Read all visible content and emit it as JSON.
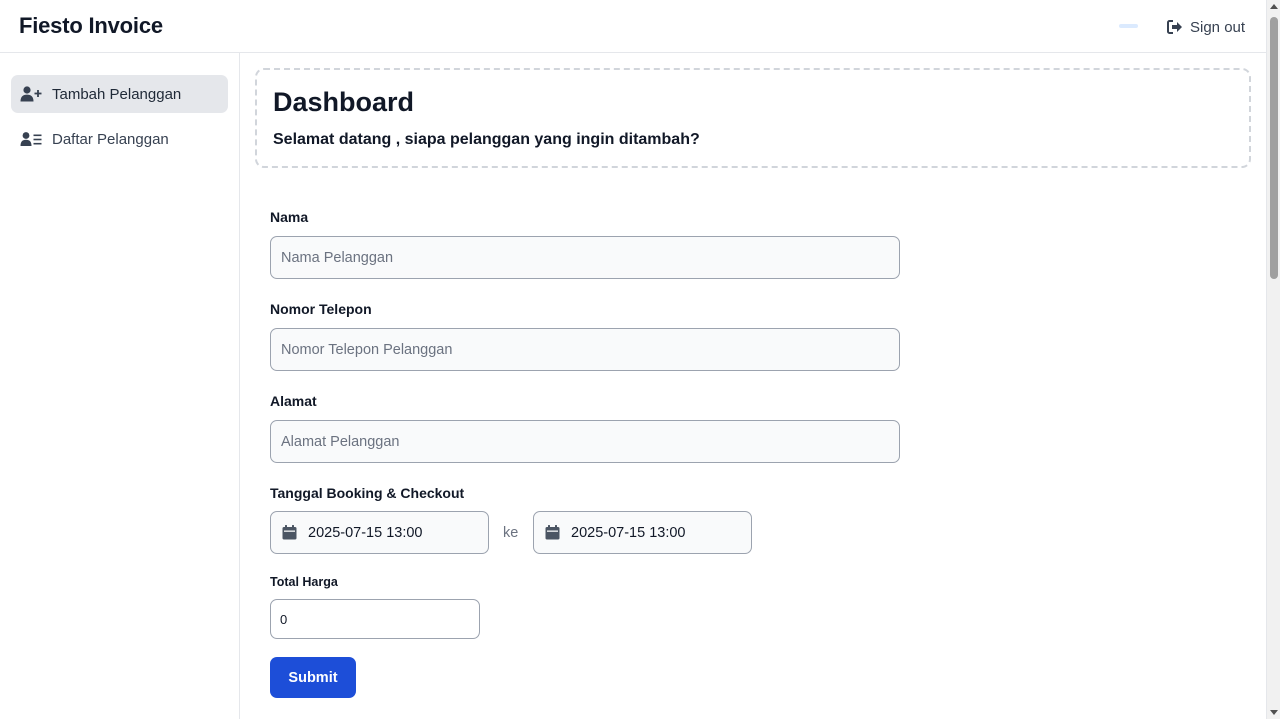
{
  "app": {
    "title": "Fiesto Invoice",
    "sign_out_label": "Sign out"
  },
  "sidebar": {
    "items": [
      {
        "label": "Tambah Pelanggan",
        "icon": "user-plus-icon",
        "active": true
      },
      {
        "label": "Daftar Pelanggan",
        "icon": "user-list-icon",
        "active": false
      }
    ]
  },
  "dashboard": {
    "title": "Dashboard",
    "subtitle": "Selamat datang , siapa pelanggan yang ingin ditambah?"
  },
  "form": {
    "nama": {
      "label": "Nama",
      "placeholder": "Nama Pelanggan",
      "value": ""
    },
    "telepon": {
      "label": "Nomor Telepon",
      "placeholder": "Nomor Telepon Pelanggan",
      "value": ""
    },
    "alamat": {
      "label": "Alamat",
      "placeholder": "Alamat Pelanggan",
      "value": ""
    },
    "tanggal": {
      "label": "Tanggal Booking & Checkout",
      "booking": "2025-07-15 13:00",
      "separator": "ke",
      "checkout": "2025-07-15 13:00",
      "icon": "calendar-icon"
    },
    "total_harga": {
      "label": "Total Harga",
      "value": "0"
    },
    "submit_label": "Submit"
  },
  "colors": {
    "primary": "#1d4ed8",
    "active_nav_bg": "#e5e7eb",
    "input_bg": "#f9fafb",
    "input_border": "#9ca3af"
  }
}
